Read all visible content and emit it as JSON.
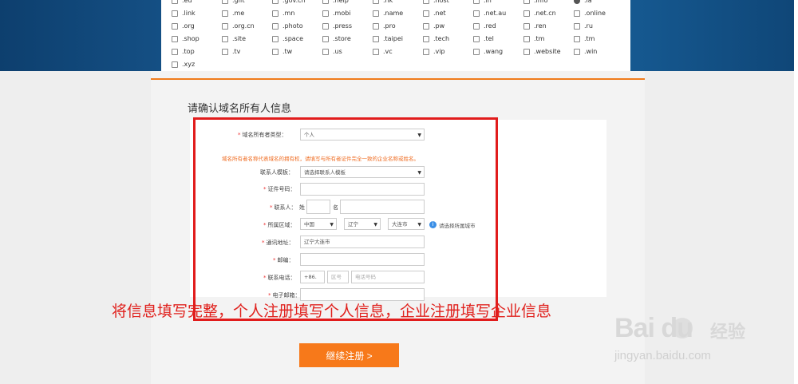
{
  "tlds": {
    "rows": [
      [
        ".ed",
        ".gift",
        ".gov.cn",
        ".help",
        ".hk",
        ".host",
        ".in",
        ".info",
        ".la"
      ],
      [
        ".link",
        ".me",
        ".mn",
        ".mobi",
        ".name",
        ".net",
        ".net.au",
        ".net.cn",
        ".online"
      ],
      [
        ".org",
        ".org.cn",
        ".photo",
        ".press",
        ".pro",
        ".pw",
        ".red",
        ".ren",
        ".ru"
      ],
      [
        ".shop",
        ".site",
        ".space",
        ".store",
        ".taipei",
        ".tech",
        ".tel",
        ".tm",
        ".tm"
      ],
      [
        ".top",
        ".tv",
        ".tw",
        ".us",
        ".vc",
        ".vip",
        ".wang",
        ".website",
        ".win"
      ],
      [
        ".xyz"
      ]
    ],
    "checked": ".la"
  },
  "form": {
    "section_title": "请确认域名所有人信息",
    "owner_type_label": "域名所有者类型：",
    "owner_type_value": "个人",
    "notice": "域名所有者名称代表域名的拥有权，请填写与所有者证件完全一致的企业名称或姓名。",
    "contact_template_label": "联系人模板：",
    "contact_template_value": "请选择联系人模板",
    "id_number_label": "证件号码：",
    "contact_label": "联系人：",
    "surname_label": "姓",
    "given_name_label": "名",
    "region_label": "所属区域：",
    "country": "中国",
    "province": "辽宁",
    "city": "大连市",
    "region_hint": "请选择所属城市",
    "address_label": "通讯地址：",
    "address_value": "辽宁大连市",
    "postcode_label": "邮编：",
    "phone_label": "联系电话：",
    "phone_prefix": "+86.",
    "area_code_placeholder": "区号",
    "phone_placeholder": "电话号码",
    "email_label": "电子邮箱：",
    "star": "*",
    "info_icon": "i",
    "select_arrow": "▼"
  },
  "caption": "将信息填写完整，个人注册填写个人信息，企业注册填写企业信息",
  "submit_label": "继续注册 >",
  "watermark": {
    "logo": "Bai  du",
    "cn": "经验",
    "url": "jingyan.baidu.com"
  }
}
